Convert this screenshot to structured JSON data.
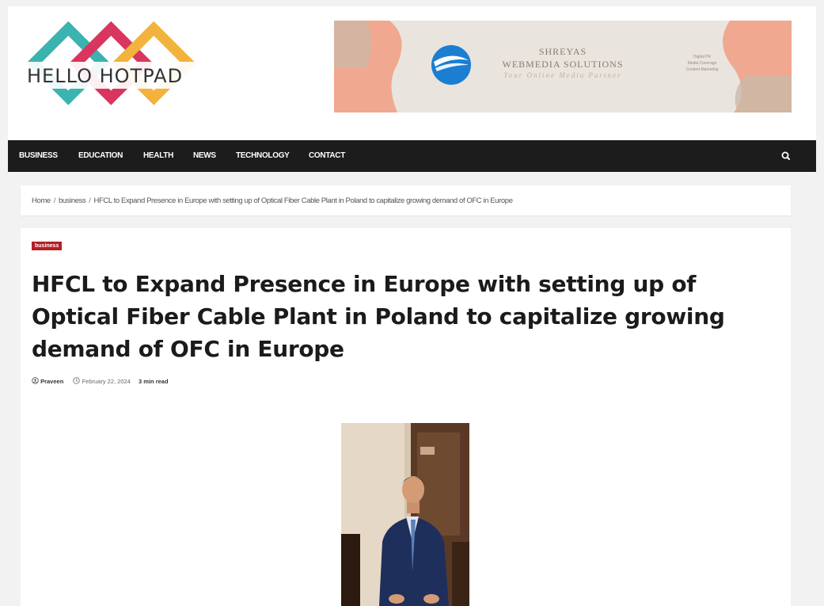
{
  "site": {
    "logo_text": "HELLO HOTPAD",
    "logo_colors": [
      "#3bb3b0",
      "#d8365f",
      "#f2b33d"
    ]
  },
  "ad": {
    "line1": "SHREYAS",
    "line2": "WEBMEDIA SOLUTIONS",
    "line3": "Your Online Media Partner",
    "side_lines": [
      "Digital PR",
      "Media Coverage",
      "Content Marketing"
    ]
  },
  "nav": {
    "items": [
      "BUSINESS",
      "EDUCATION",
      "HEALTH",
      "NEWS",
      "TECHNOLOGY",
      "CONTACT"
    ],
    "search_icon": "search-icon"
  },
  "breadcrumb": {
    "home": "Home",
    "category": "business",
    "current": "HFCL to Expand Presence in Europe with setting up of Optical Fiber Cable Plant in Poland to capitalize growing demand of OFC in Europe"
  },
  "article": {
    "category_badge": "business",
    "title": "HFCL to Expand Presence in Europe with setting up of Optical Fiber Cable Plant in Poland to capitalize growing demand of OFC in Europe",
    "author": "Praveen",
    "date": "February 22, 2024",
    "read_time": "3 min read",
    "accent_color": "#b41f24"
  }
}
